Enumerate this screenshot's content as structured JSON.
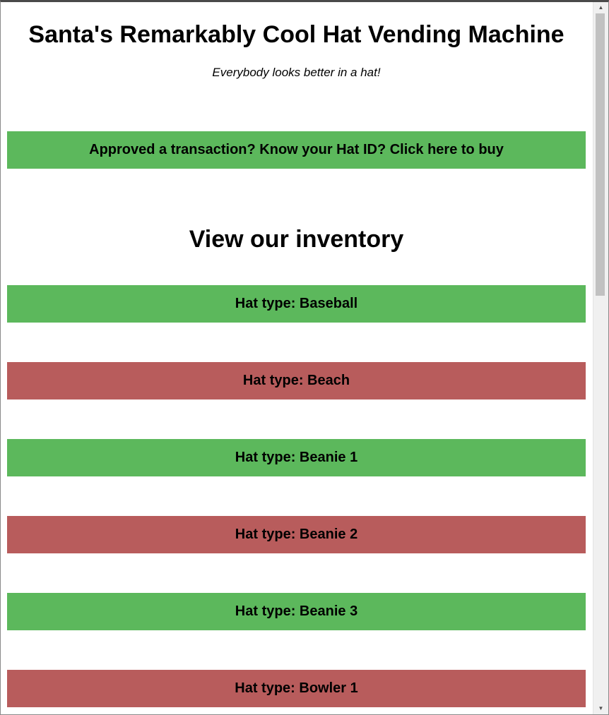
{
  "page": {
    "title": "Santa's Remarkably Cool Hat Vending Machine",
    "tagline": "Everybody looks better in a hat!",
    "buy_button": "Approved a transaction? Know your Hat ID? Click here to buy",
    "inventory_heading": "View our inventory"
  },
  "inventory": [
    {
      "label": "Hat type: Baseball",
      "status_color": "#5cb85c"
    },
    {
      "label": "Hat type: Beach",
      "status_color": "#b85c5c"
    },
    {
      "label": "Hat type: Beanie 1",
      "status_color": "#5cb85c"
    },
    {
      "label": "Hat type: Beanie 2",
      "status_color": "#b85c5c"
    },
    {
      "label": "Hat type: Beanie 3",
      "status_color": "#5cb85c"
    },
    {
      "label": "Hat type: Bowler 1",
      "status_color": "#b85c5c"
    }
  ],
  "scrollbar": {
    "up_icon": "chevron-up-icon",
    "down_icon": "chevron-down-icon"
  }
}
